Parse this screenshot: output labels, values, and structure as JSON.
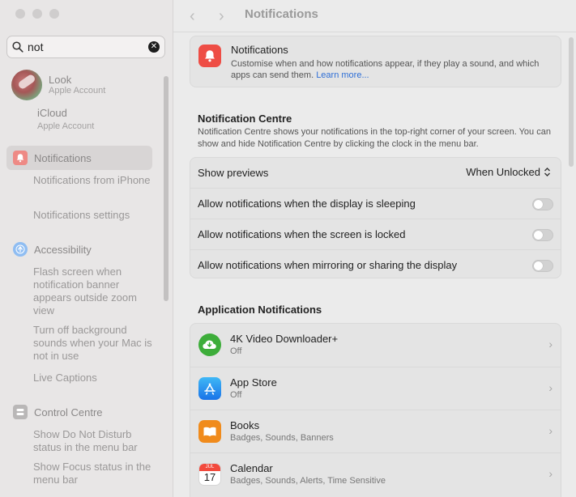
{
  "window": {
    "title": "Notifications"
  },
  "search": {
    "value": "not"
  },
  "account": {
    "name": "Look",
    "subtitle": "Apple Account"
  },
  "icloud": {
    "name": "iCloud",
    "subtitle": "Apple Account"
  },
  "sidebar": {
    "notifications": {
      "label": "Notifications",
      "subitems": [
        "Notifications from iPhone",
        "Notifications settings"
      ]
    },
    "accessibility": {
      "label": "Accessibility",
      "subitems": [
        "Flash screen when notification banner appears outside zoom view",
        "Turn off background sounds when your Mac is not in use",
        "Live Captions"
      ]
    },
    "control_centre": {
      "label": "Control Centre",
      "subitems": [
        "Show Do Not Disturb status in the menu bar",
        "Show Focus status in the menu bar"
      ]
    }
  },
  "top_card": {
    "title": "Notifications",
    "description": "Customise when and how notifications appear, if they play a sound, and which apps can send them.",
    "link": "Learn more..."
  },
  "notification_centre": {
    "heading": "Notification Centre",
    "description": "Notification Centre shows your notifications in the top-right corner of your screen. You can show and hide Notification Centre by clicking the clock in the menu bar.",
    "show_previews_label": "Show previews",
    "show_previews_value": "When Unlocked",
    "toggles": [
      {
        "label": "Allow notifications when the display is sleeping",
        "on": false
      },
      {
        "label": "Allow notifications when the screen is locked",
        "on": false
      },
      {
        "label": "Allow notifications when mirroring or sharing the display",
        "on": false
      }
    ]
  },
  "app_notifications": {
    "heading": "Application Notifications",
    "apps": [
      {
        "name": "4K Video Downloader+",
        "status": "Off",
        "icon": "cloud-download-icon"
      },
      {
        "name": "App Store",
        "status": "Off",
        "icon": "app-store-icon"
      },
      {
        "name": "Books",
        "status": "Badges, Sounds, Banners",
        "icon": "books-icon"
      },
      {
        "name": "Calendar",
        "status": "Badges, Sounds, Alerts, Time Sensitive",
        "icon": "calendar-icon",
        "calendar_month": "JUL",
        "calendar_day": "17"
      }
    ]
  },
  "colors": {
    "notifications_red": "#ee4d45",
    "accessibility_blue": "#3a8ef0",
    "link_blue": "#2f6fd6",
    "video_green": "#3dad3a",
    "books_orange": "#f08b1c"
  }
}
